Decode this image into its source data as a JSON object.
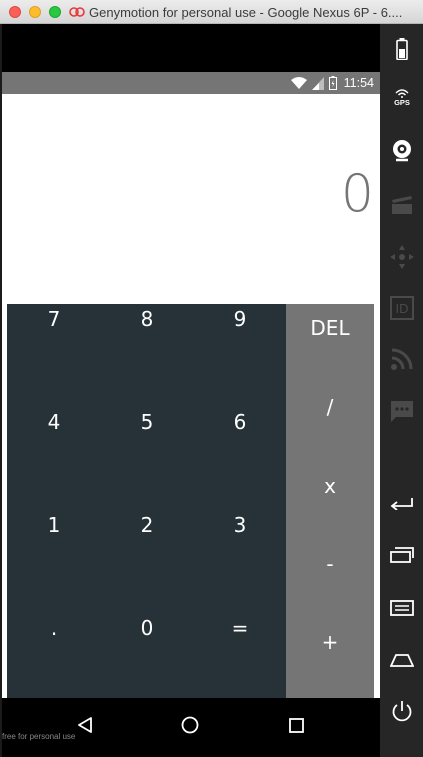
{
  "window": {
    "title": "Genymotion for personal use - Google Nexus 6P - 6...."
  },
  "status_bar": {
    "time": "11:54"
  },
  "calculator": {
    "display": "0",
    "digits": {
      "k7": "7",
      "k8": "8",
      "k9": "9",
      "k4": "4",
      "k5": "5",
      "k6": "6",
      "k1": "1",
      "k2": "2",
      "k3": "3",
      "dot": ".",
      "k0": "0",
      "equals": "="
    },
    "ops": {
      "del": "DEL",
      "divide": "/",
      "multiply": "x",
      "minus": "-",
      "plus": "+"
    }
  },
  "watermark": "free for personal use",
  "toolbar": {
    "gps_label": "GPS",
    "id_label": "ID",
    "items": [
      "battery-icon",
      "gps-icon",
      "webcam-icon",
      "capture-icon",
      "dpad-icon",
      "id-icon",
      "rss-icon",
      "sms-icon",
      "back-icon",
      "recent-apps-icon",
      "menu-icon",
      "home-icon",
      "power-icon"
    ]
  },
  "colors": {
    "keypad_dark": "#263238",
    "keypad_ops": "#757575",
    "display_text": "#757575"
  }
}
